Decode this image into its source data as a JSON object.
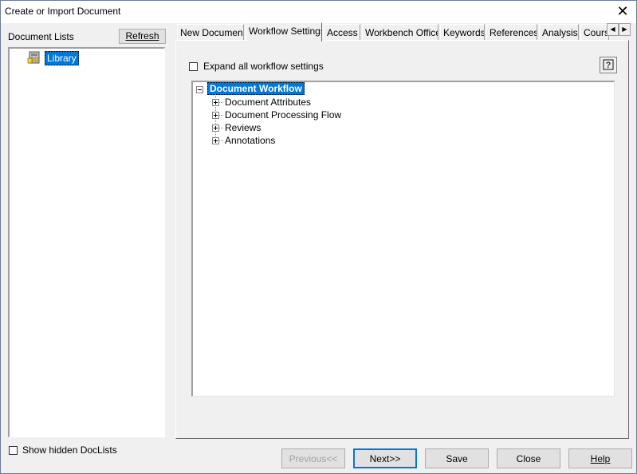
{
  "window": {
    "title": "Create or Import Document",
    "close_glyph": "✕"
  },
  "left_panel": {
    "label": "Document Lists",
    "refresh_label": "Refresh",
    "items": [
      {
        "label": "Library",
        "icon": "library-icon"
      }
    ],
    "show_hidden_label": "Show hidden DocLists"
  },
  "tabs": [
    {
      "label": "New Document",
      "active": false
    },
    {
      "label": "Workflow Settings",
      "active": true
    },
    {
      "label": "Access",
      "active": false
    },
    {
      "label": "Workbench Office",
      "active": false
    },
    {
      "label": "Keywords",
      "active": false
    },
    {
      "label": "References",
      "active": false
    },
    {
      "label": "Analysis",
      "active": false
    },
    {
      "label": "Cours",
      "active": false
    }
  ],
  "workflow": {
    "expand_all_label": "Expand all workflow settings",
    "tree": {
      "root": "Document Workflow",
      "children": [
        "Document Attributes",
        "Document Processing Flow",
        "Reviews",
        "Annotations"
      ]
    }
  },
  "footer": {
    "previous_label": "Previous<<",
    "next_label": "Next>>",
    "save_label": "Save",
    "close_label": "Close",
    "help_label": "Help"
  }
}
